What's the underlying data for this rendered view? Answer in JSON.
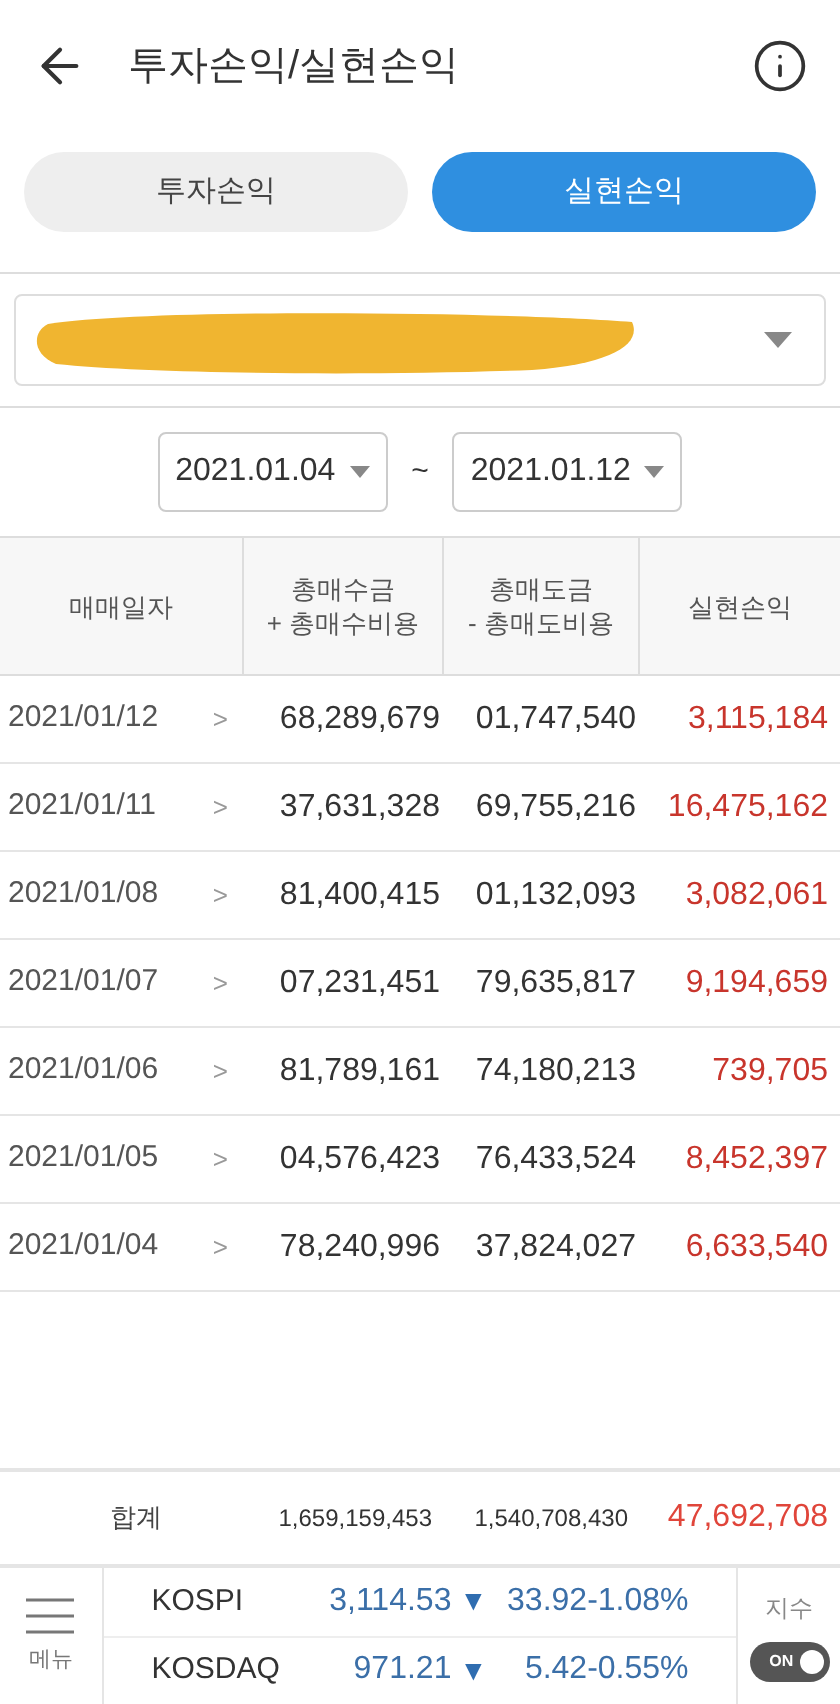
{
  "header": {
    "title": "투자손익/실현손익"
  },
  "tabs": [
    {
      "label": "투자손익",
      "selected": false
    },
    {
      "label": "실현손익",
      "selected": true
    }
  ],
  "account_select": {
    "redacted": true
  },
  "date_range": {
    "start": "2021.01.04",
    "separator": "~",
    "end": "2021.01.12"
  },
  "table": {
    "columns": [
      {
        "lines": [
          "매매일자"
        ]
      },
      {
        "lines": [
          "총매수금",
          "+ 총매수비용"
        ]
      },
      {
        "lines": [
          "총매도금",
          "- 총매도비용"
        ]
      },
      {
        "lines": [
          "실현손익"
        ]
      }
    ],
    "rows": [
      {
        "date": "2021/01/12",
        "chevron": ">",
        "buy": "68,289,679",
        "sell": "01,747,540",
        "profit": "3,115,184"
      },
      {
        "date": "2021/01/11",
        "chevron": ">",
        "buy": "37,631,328",
        "sell": "69,755,216",
        "profit": "16,475,162"
      },
      {
        "date": "2021/01/08",
        "chevron": ">",
        "buy": "81,400,415",
        "sell": "01,132,093",
        "profit": "3,082,061"
      },
      {
        "date": "2021/01/07",
        "chevron": ">",
        "buy": "07,231,451",
        "sell": "79,635,817",
        "profit": "9,194,659"
      },
      {
        "date": "2021/01/06",
        "chevron": ">",
        "buy": "81,789,161",
        "sell": "74,180,213",
        "profit": "739,705"
      },
      {
        "date": "2021/01/05",
        "chevron": ">",
        "buy": "04,576,423",
        "sell": "76,433,524",
        "profit": "8,452,397"
      },
      {
        "date": "2021/01/04",
        "chevron": ">",
        "buy": "78,240,996",
        "sell": "37,824,027",
        "profit": "6,633,540"
      }
    ],
    "total": {
      "label": "합계",
      "buy": "1,659,159,453",
      "sell": "1,540,708,430",
      "profit": "47,692,708"
    }
  },
  "bottom_bar": {
    "menu_label": "메뉴",
    "indices": [
      {
        "name": "KOSPI",
        "value": "3,114.53",
        "arrow": "▼",
        "change": "33.92",
        "percent": "-1.08%"
      },
      {
        "name": "KOSDAQ",
        "value": "971.21",
        "arrow": "▼",
        "change": "5.42",
        "percent": "-0.55%"
      }
    ],
    "index_label": "지수",
    "toggle": {
      "label": "ON",
      "on": true
    }
  }
}
